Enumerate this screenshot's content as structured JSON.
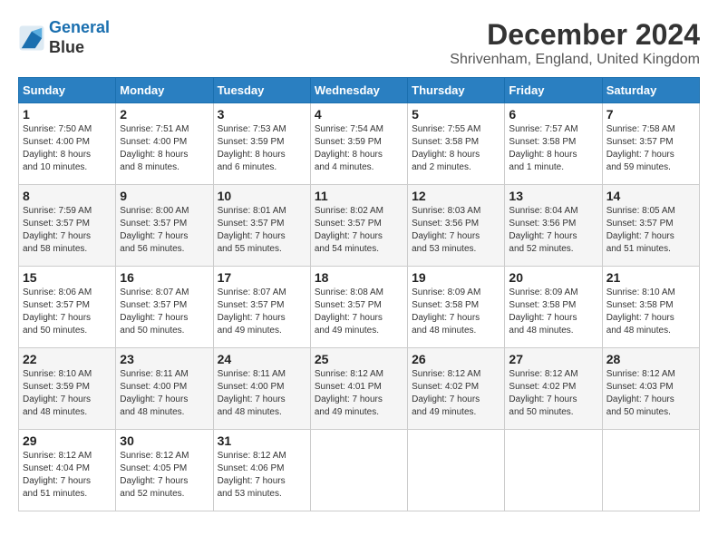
{
  "header": {
    "logo_line1": "General",
    "logo_line2": "Blue",
    "month_year": "December 2024",
    "location": "Shrivenham, England, United Kingdom"
  },
  "weekdays": [
    "Sunday",
    "Monday",
    "Tuesday",
    "Wednesday",
    "Thursday",
    "Friday",
    "Saturday"
  ],
  "weeks": [
    [
      {
        "day": "1",
        "info": "Sunrise: 7:50 AM\nSunset: 4:00 PM\nDaylight: 8 hours\nand 10 minutes."
      },
      {
        "day": "2",
        "info": "Sunrise: 7:51 AM\nSunset: 4:00 PM\nDaylight: 8 hours\nand 8 minutes."
      },
      {
        "day": "3",
        "info": "Sunrise: 7:53 AM\nSunset: 3:59 PM\nDaylight: 8 hours\nand 6 minutes."
      },
      {
        "day": "4",
        "info": "Sunrise: 7:54 AM\nSunset: 3:59 PM\nDaylight: 8 hours\nand 4 minutes."
      },
      {
        "day": "5",
        "info": "Sunrise: 7:55 AM\nSunset: 3:58 PM\nDaylight: 8 hours\nand 2 minutes."
      },
      {
        "day": "6",
        "info": "Sunrise: 7:57 AM\nSunset: 3:58 PM\nDaylight: 8 hours\nand 1 minute."
      },
      {
        "day": "7",
        "info": "Sunrise: 7:58 AM\nSunset: 3:57 PM\nDaylight: 7 hours\nand 59 minutes."
      }
    ],
    [
      {
        "day": "8",
        "info": "Sunrise: 7:59 AM\nSunset: 3:57 PM\nDaylight: 7 hours\nand 58 minutes."
      },
      {
        "day": "9",
        "info": "Sunrise: 8:00 AM\nSunset: 3:57 PM\nDaylight: 7 hours\nand 56 minutes."
      },
      {
        "day": "10",
        "info": "Sunrise: 8:01 AM\nSunset: 3:57 PM\nDaylight: 7 hours\nand 55 minutes."
      },
      {
        "day": "11",
        "info": "Sunrise: 8:02 AM\nSunset: 3:57 PM\nDaylight: 7 hours\nand 54 minutes."
      },
      {
        "day": "12",
        "info": "Sunrise: 8:03 AM\nSunset: 3:56 PM\nDaylight: 7 hours\nand 53 minutes."
      },
      {
        "day": "13",
        "info": "Sunrise: 8:04 AM\nSunset: 3:56 PM\nDaylight: 7 hours\nand 52 minutes."
      },
      {
        "day": "14",
        "info": "Sunrise: 8:05 AM\nSunset: 3:57 PM\nDaylight: 7 hours\nand 51 minutes."
      }
    ],
    [
      {
        "day": "15",
        "info": "Sunrise: 8:06 AM\nSunset: 3:57 PM\nDaylight: 7 hours\nand 50 minutes."
      },
      {
        "day": "16",
        "info": "Sunrise: 8:07 AM\nSunset: 3:57 PM\nDaylight: 7 hours\nand 50 minutes."
      },
      {
        "day": "17",
        "info": "Sunrise: 8:07 AM\nSunset: 3:57 PM\nDaylight: 7 hours\nand 49 minutes."
      },
      {
        "day": "18",
        "info": "Sunrise: 8:08 AM\nSunset: 3:57 PM\nDaylight: 7 hours\nand 49 minutes."
      },
      {
        "day": "19",
        "info": "Sunrise: 8:09 AM\nSunset: 3:58 PM\nDaylight: 7 hours\nand 48 minutes."
      },
      {
        "day": "20",
        "info": "Sunrise: 8:09 AM\nSunset: 3:58 PM\nDaylight: 7 hours\nand 48 minutes."
      },
      {
        "day": "21",
        "info": "Sunrise: 8:10 AM\nSunset: 3:58 PM\nDaylight: 7 hours\nand 48 minutes."
      }
    ],
    [
      {
        "day": "22",
        "info": "Sunrise: 8:10 AM\nSunset: 3:59 PM\nDaylight: 7 hours\nand 48 minutes."
      },
      {
        "day": "23",
        "info": "Sunrise: 8:11 AM\nSunset: 4:00 PM\nDaylight: 7 hours\nand 48 minutes."
      },
      {
        "day": "24",
        "info": "Sunrise: 8:11 AM\nSunset: 4:00 PM\nDaylight: 7 hours\nand 48 minutes."
      },
      {
        "day": "25",
        "info": "Sunrise: 8:12 AM\nSunset: 4:01 PM\nDaylight: 7 hours\nand 49 minutes."
      },
      {
        "day": "26",
        "info": "Sunrise: 8:12 AM\nSunset: 4:02 PM\nDaylight: 7 hours\nand 49 minutes."
      },
      {
        "day": "27",
        "info": "Sunrise: 8:12 AM\nSunset: 4:02 PM\nDaylight: 7 hours\nand 50 minutes."
      },
      {
        "day": "28",
        "info": "Sunrise: 8:12 AM\nSunset: 4:03 PM\nDaylight: 7 hours\nand 50 minutes."
      }
    ],
    [
      {
        "day": "29",
        "info": "Sunrise: 8:12 AM\nSunset: 4:04 PM\nDaylight: 7 hours\nand 51 minutes."
      },
      {
        "day": "30",
        "info": "Sunrise: 8:12 AM\nSunset: 4:05 PM\nDaylight: 7 hours\nand 52 minutes."
      },
      {
        "day": "31",
        "info": "Sunrise: 8:12 AM\nSunset: 4:06 PM\nDaylight: 7 hours\nand 53 minutes."
      },
      null,
      null,
      null,
      null
    ]
  ]
}
